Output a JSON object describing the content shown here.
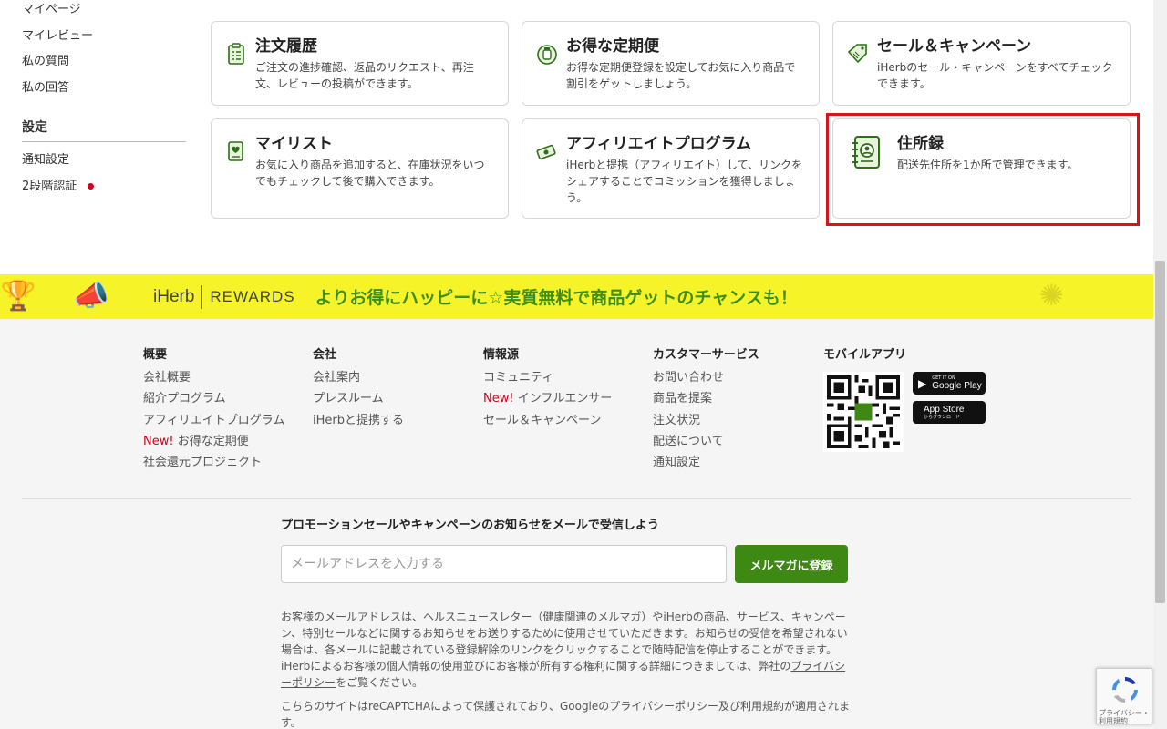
{
  "sidebar": {
    "links": [
      "マイページ",
      "マイレビュー",
      "私の質問",
      "私の回答"
    ],
    "settings_heading": "設定",
    "settings_links": [
      "通知設定",
      "2段階認証"
    ]
  },
  "cards": [
    {
      "title": "注文履歴",
      "desc": "ご注文の進捗確認、返品のリクエスト、再注文、レビューの投稿ができます。",
      "icon": "clipboard-icon"
    },
    {
      "title": "お得な定期便",
      "desc": "お得な定期便登録を設定してお気に入り商品で割引をゲットしましょう。",
      "icon": "subscription-bottle-icon"
    },
    {
      "title": "セール＆キャンペーン",
      "desc": "iHerbのセール・キャンペーンをすべてチェックできます。",
      "icon": "sale-tag-icon"
    },
    {
      "title": "マイリスト",
      "desc": "お気に入り商品を追加すると、在庫状況をいつでもチェックして後で購入できます。",
      "icon": "heart-list-icon"
    },
    {
      "title": "アフィリエイトプログラム",
      "desc": "iHerbと提携（アフィリエイト）して、リンクをシェアすることでコミッションを獲得しましょう。",
      "icon": "money-icon"
    },
    {
      "title": "住所録",
      "desc": "配送先住所を1か所で管理できます。",
      "icon": "address-book-icon"
    }
  ],
  "banner": {
    "brand": "iHerb",
    "rewards": "REWARDS",
    "text": "よりお得にハッピーに☆実質無料で商品ゲットのチャンスも！"
  },
  "footer": {
    "columns": [
      {
        "heading": "概要",
        "links": [
          {
            "new": "",
            "text": "会社概要"
          },
          {
            "new": "",
            "text": "紹介プログラム"
          },
          {
            "new": "",
            "text": "アフィリエイトプログラム"
          },
          {
            "new": "New!",
            "text": " お得な定期便"
          },
          {
            "new": "",
            "text": "社会還元プロジェクト"
          }
        ]
      },
      {
        "heading": "会社",
        "links": [
          {
            "new": "",
            "text": "会社案内"
          },
          {
            "new": "",
            "text": "プレスルーム"
          },
          {
            "new": "",
            "text": "iHerbと提携する"
          }
        ]
      },
      {
        "heading": "情報源",
        "links": [
          {
            "new": "",
            "text": "コミュニティ"
          },
          {
            "new": "New!",
            "text": " インフルエンサー"
          },
          {
            "new": "",
            "text": "セール＆キャンペーン"
          }
        ]
      },
      {
        "heading": "カスタマーサービス",
        "links": [
          {
            "new": "",
            "text": "お問い合わせ"
          },
          {
            "new": "",
            "text": "商品を提案"
          },
          {
            "new": "",
            "text": "注文状況"
          },
          {
            "new": "",
            "text": "配送について"
          },
          {
            "new": "",
            "text": "通知設定"
          }
        ]
      },
      {
        "heading": "モバイルアプリ",
        "links": []
      }
    ],
    "google_play": {
      "small": "GET IT ON",
      "big": "Google Play"
    },
    "app_store": {
      "big": "App Store",
      "small": "からダウンロード"
    },
    "newsletter_heading": "プロモーションセールやキャンペーンのお知らせをメールで受信しよう",
    "email_placeholder": "メールアドレスを入力する",
    "subscribe_label": "メルマガに登録",
    "legal_before": "お客様のメールアドレスは、ヘルスニュースレター（健康関連のメルマガ）やiHerbの商品、サービス、キャンペーン、特別セールなどに関するお知らせをお送りするために使用させていただきます。お知らせの受信を希望されない場合は、各メールに記載されている登録解除のリンクをクリックすることで随時配信を停止することができます。iHerbによるお客様の個人情報の使用並びにお客様が所有する権利に関する詳細につきましては、弊社の",
    "privacy_link": "プライバシーポリシー",
    "legal_after": "をご覧ください。",
    "recaptcha_notice": "こちらのサイトはreCAPTCHAによって保護されており、Googleのプライバシーポリシー及び利用規約が適用されます。"
  },
  "recaptcha": {
    "line1": "プライバシー・",
    "line2": "利用規約"
  },
  "colors": {
    "accent_green": "#3e8814",
    "banner_yellow": "#f6f429",
    "highlight_red": "#d7141e",
    "new_red": "#d0021b"
  }
}
